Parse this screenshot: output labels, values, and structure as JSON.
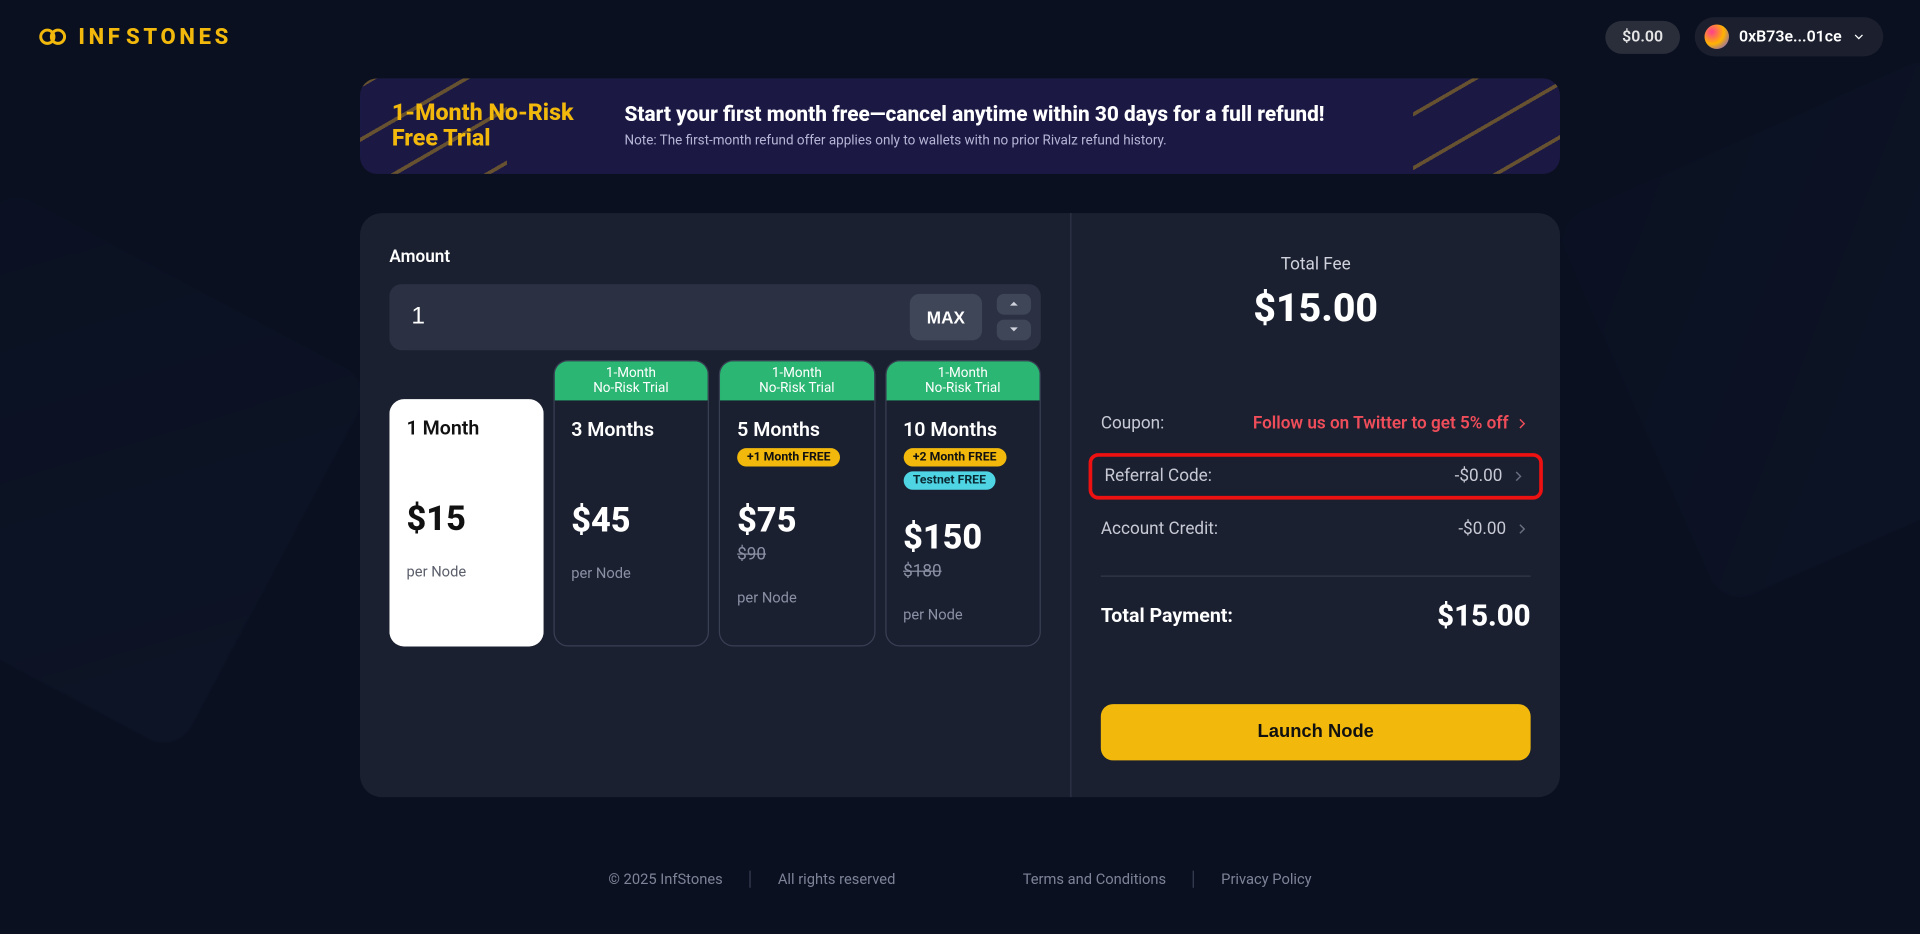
{
  "header": {
    "brand_inf": "INF",
    "brand_stones": "STONES",
    "balance": "$0.00",
    "wallet": "0xB73e...01ce"
  },
  "banner": {
    "title_line1": "1-Month No-Risk",
    "title_line2": "Free Trial",
    "headline": "Start your first month free—cancel anytime within 30 days for a full refund!",
    "note": "Note: The first-month refund offer applies only to wallets with no prior Rivalz refund history."
  },
  "amount": {
    "label": "Amount",
    "value": "1",
    "max_label": "MAX"
  },
  "trial_label_1": "1-Month",
  "trial_label_2": "No-Risk Trial",
  "plans": [
    {
      "title": "1 Month",
      "price": "$15",
      "strike": "",
      "bonus_yellow": "",
      "bonus_teal": "",
      "per": "per Node",
      "trial": false,
      "selected": true
    },
    {
      "title": "3 Months",
      "price": "$45",
      "strike": "",
      "bonus_yellow": "",
      "bonus_teal": "",
      "per": "per Node",
      "trial": true,
      "selected": false
    },
    {
      "title": "5 Months",
      "price": "$75",
      "strike": "$90",
      "bonus_yellow": "+1 Month FREE",
      "bonus_teal": "",
      "per": "per Node",
      "trial": true,
      "selected": false
    },
    {
      "title": "10 Months",
      "price": "$150",
      "strike": "$180",
      "bonus_yellow": "+2 Month FREE",
      "bonus_teal": "Testnet FREE",
      "per": "per Node",
      "trial": true,
      "selected": false
    }
  ],
  "fee": {
    "label": "Total Fee",
    "amount": "$15.00"
  },
  "rows": {
    "coupon_label": "Coupon:",
    "coupon_link": "Follow us on Twitter to get 5% off",
    "referral_label": "Referral Code:",
    "referral_value": "-$0.00",
    "credit_label": "Account Credit:",
    "credit_value": "-$0.00"
  },
  "total": {
    "label": "Total Payment:",
    "amount": "$15.00"
  },
  "launch_label": "Launch Node",
  "footer": {
    "copyright": "© 2025 InfStones",
    "rights": "All rights reserved",
    "terms": "Terms and Conditions",
    "privacy": "Privacy Policy"
  }
}
